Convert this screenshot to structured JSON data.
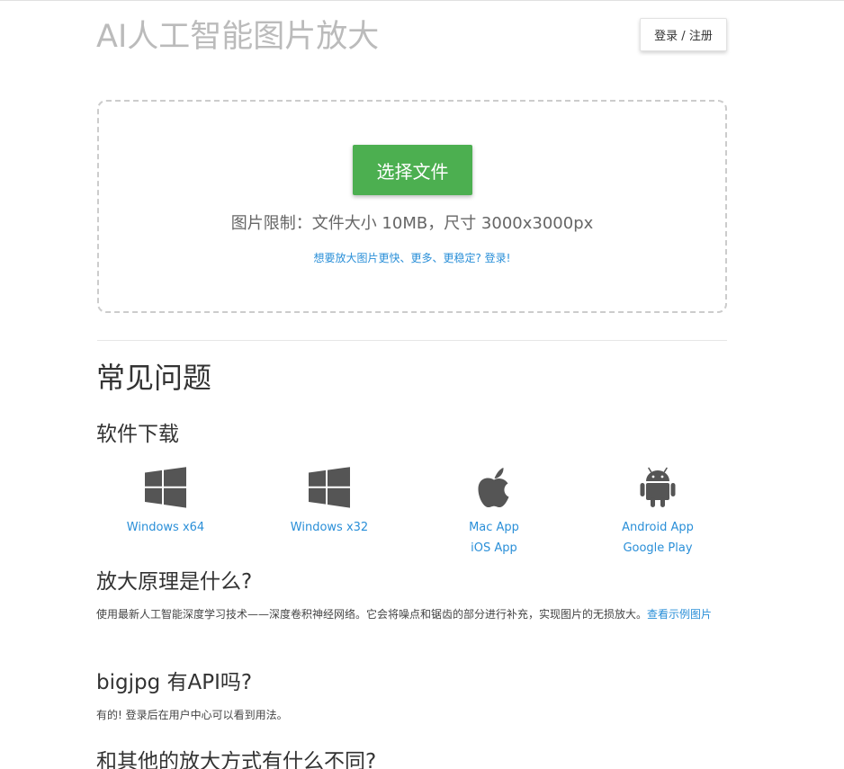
{
  "header": {
    "title": "AI人工智能图片放大",
    "login_label": "登录 / 注册"
  },
  "upload": {
    "choose_label": "选择文件",
    "limit_text": "图片限制：文件大小 10MB，尺寸 3000x3000px",
    "more_link": "想要放大图片更快、更多、更稳定? 登录!"
  },
  "faq": {
    "title": "常见问题",
    "download": {
      "heading": "软件下载",
      "items": [
        {
          "icon": "windows-icon",
          "links": [
            "Windows x64"
          ]
        },
        {
          "icon": "windows-icon",
          "links": [
            "Windows x32"
          ]
        },
        {
          "icon": "apple-icon",
          "links": [
            "Mac App",
            "iOS App"
          ]
        },
        {
          "icon": "android-icon",
          "links": [
            "Android App",
            "Google Play"
          ]
        }
      ]
    },
    "principle": {
      "heading": "放大原理是什么?",
      "text": "使用最新人工智能深度学习技术——深度卷积神经网络。它会将噪点和锯齿的部分进行补充，实现图片的无损放大。",
      "link": "查看示例图片"
    },
    "api": {
      "heading": "bigjpg 有API吗?",
      "text": "有的! 登录后在用户中心可以看到用法。"
    },
    "diff": {
      "heading": "和其他的放大方式有什么不同?"
    }
  },
  "colors": {
    "accent_green": "#4caf50",
    "link_blue": "#2a8fd8",
    "title_gray": "#bbbbbb",
    "icon_gray": "#555555"
  }
}
